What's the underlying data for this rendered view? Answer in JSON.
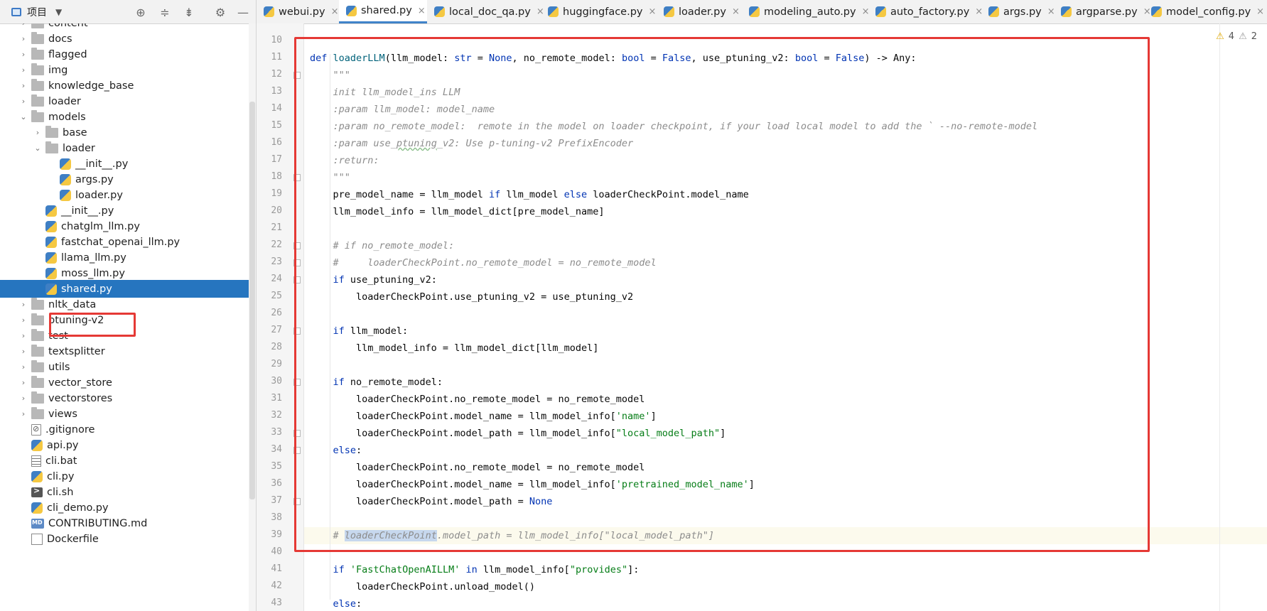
{
  "sidebar": {
    "title": "项目",
    "caret": "▼",
    "icons": {
      "locate": "⊕",
      "expand": "≑",
      "collapse": "⇟",
      "settings": "⚙",
      "hide": "—"
    },
    "tree": [
      {
        "label": "content",
        "arrow": "›",
        "icon": "folder",
        "depth": 1,
        "partial": true
      },
      {
        "label": "docs",
        "arrow": "›",
        "icon": "folder",
        "depth": 1
      },
      {
        "label": "flagged",
        "arrow": "›",
        "icon": "folder",
        "depth": 1
      },
      {
        "label": "img",
        "arrow": "›",
        "icon": "folder",
        "depth": 1
      },
      {
        "label": "knowledge_base",
        "arrow": "›",
        "icon": "folder",
        "depth": 1
      },
      {
        "label": "loader",
        "arrow": "›",
        "icon": "folder",
        "depth": 1
      },
      {
        "label": "models",
        "arrow": "⌄",
        "icon": "folder",
        "depth": 1
      },
      {
        "label": "base",
        "arrow": "›",
        "icon": "folder",
        "depth": 2
      },
      {
        "label": "loader",
        "arrow": "⌄",
        "icon": "folder",
        "depth": 2
      },
      {
        "label": "__init__.py",
        "arrow": "",
        "icon": "py",
        "depth": 3
      },
      {
        "label": "args.py",
        "arrow": "",
        "icon": "py",
        "depth": 3
      },
      {
        "label": "loader.py",
        "arrow": "",
        "icon": "py",
        "depth": 3
      },
      {
        "label": "__init__.py",
        "arrow": "",
        "icon": "py",
        "depth": 2
      },
      {
        "label": "chatglm_llm.py",
        "arrow": "",
        "icon": "py",
        "depth": 2
      },
      {
        "label": "fastchat_openai_llm.py",
        "arrow": "",
        "icon": "py",
        "depth": 2
      },
      {
        "label": "llama_llm.py",
        "arrow": "",
        "icon": "py",
        "depth": 2
      },
      {
        "label": "moss_llm.py",
        "arrow": "",
        "icon": "py",
        "depth": 2
      },
      {
        "label": "shared.py",
        "arrow": "",
        "icon": "py",
        "depth": 2,
        "selected": true
      },
      {
        "label": "nltk_data",
        "arrow": "›",
        "icon": "folder",
        "depth": 1
      },
      {
        "label": "ptuning-v2",
        "arrow": "›",
        "icon": "folder",
        "depth": 1
      },
      {
        "label": "test",
        "arrow": "›",
        "icon": "folder",
        "depth": 1
      },
      {
        "label": "textsplitter",
        "arrow": "›",
        "icon": "folder",
        "depth": 1
      },
      {
        "label": "utils",
        "arrow": "›",
        "icon": "folder",
        "depth": 1
      },
      {
        "label": "vector_store",
        "arrow": "›",
        "icon": "folder",
        "depth": 1
      },
      {
        "label": "vectorstores",
        "arrow": "›",
        "icon": "folder",
        "depth": 1
      },
      {
        "label": "views",
        "arrow": "›",
        "icon": "folder",
        "depth": 1
      },
      {
        "label": ".gitignore",
        "arrow": "",
        "icon": "git",
        "depth": 1
      },
      {
        "label": "api.py",
        "arrow": "",
        "icon": "py",
        "depth": 1
      },
      {
        "label": "cli.bat",
        "arrow": "",
        "icon": "bat",
        "depth": 1
      },
      {
        "label": "cli.py",
        "arrow": "",
        "icon": "py",
        "depth": 1
      },
      {
        "label": "cli.sh",
        "arrow": "",
        "icon": "sh",
        "depth": 1
      },
      {
        "label": "cli_demo.py",
        "arrow": "",
        "icon": "py",
        "depth": 1
      },
      {
        "label": "CONTRIBUTING.md",
        "arrow": "",
        "icon": "md",
        "depth": 1
      },
      {
        "label": "Dockerfile",
        "arrow": "",
        "icon": "docker",
        "depth": 1
      }
    ]
  },
  "tabs": [
    {
      "label": "webui.py",
      "active": false
    },
    {
      "label": "shared.py",
      "active": true
    },
    {
      "label": "local_doc_qa.py",
      "active": false
    },
    {
      "label": "huggingface.py",
      "active": false
    },
    {
      "label": "loader.py",
      "active": false
    },
    {
      "label": "modeling_auto.py",
      "active": false
    },
    {
      "label": "auto_factory.py",
      "active": false
    },
    {
      "label": "args.py",
      "active": false
    },
    {
      "label": "argparse.py",
      "active": false
    },
    {
      "label": "model_config.py",
      "active": false
    }
  ],
  "tab_close": "×",
  "warnings": {
    "warn_count": "4",
    "weak_count": "2",
    "warn_icon": "⚠",
    "weak_icon": "⚠"
  },
  "editor": {
    "current_line": 39,
    "lines": [
      {
        "n": 10,
        "code": ""
      },
      {
        "n": 11,
        "code": "def loaderLLM(llm_model: str = None, no_remote_model: bool = False, use_ptuning_v2: bool = False) -> Any:"
      },
      {
        "n": 12,
        "code": "    \"\"\""
      },
      {
        "n": 13,
        "code": "    init llm_model_ins LLM"
      },
      {
        "n": 14,
        "code": "    :param llm_model: model_name"
      },
      {
        "n": 15,
        "code": "    :param no_remote_model:  remote in the model on loader checkpoint, if your load local model to add the ` --no-remote-model"
      },
      {
        "n": 16,
        "code": "    :param use_ptuning_v2: Use p-tuning-v2 PrefixEncoder"
      },
      {
        "n": 17,
        "code": "    :return:"
      },
      {
        "n": 18,
        "code": "    \"\"\""
      },
      {
        "n": 19,
        "code": "    pre_model_name = llm_model if llm_model else loaderCheckPoint.model_name"
      },
      {
        "n": 20,
        "code": "    llm_model_info = llm_model_dict[pre_model_name]"
      },
      {
        "n": 21,
        "code": ""
      },
      {
        "n": 22,
        "code": "    # if no_remote_model:"
      },
      {
        "n": 23,
        "code": "    #     loaderCheckPoint.no_remote_model = no_remote_model"
      },
      {
        "n": 24,
        "code": "    if use_ptuning_v2:"
      },
      {
        "n": 25,
        "code": "        loaderCheckPoint.use_ptuning_v2 = use_ptuning_v2"
      },
      {
        "n": 26,
        "code": ""
      },
      {
        "n": 27,
        "code": "    if llm_model:"
      },
      {
        "n": 28,
        "code": "        llm_model_info = llm_model_dict[llm_model]"
      },
      {
        "n": 29,
        "code": ""
      },
      {
        "n": 30,
        "code": "    if no_remote_model:"
      },
      {
        "n": 31,
        "code": "        loaderCheckPoint.no_remote_model = no_remote_model"
      },
      {
        "n": 32,
        "code": "        loaderCheckPoint.model_name = llm_model_info['name']"
      },
      {
        "n": 33,
        "code": "        loaderCheckPoint.model_path = llm_model_info[\"local_model_path\"]"
      },
      {
        "n": 34,
        "code": "    else:"
      },
      {
        "n": 35,
        "code": "        loaderCheckPoint.no_remote_model = no_remote_model"
      },
      {
        "n": 36,
        "code": "        loaderCheckPoint.model_name = llm_model_info['pretrained_model_name']"
      },
      {
        "n": 37,
        "code": "        loaderCheckPoint.model_path = None"
      },
      {
        "n": 38,
        "code": ""
      },
      {
        "n": 39,
        "code": "    # loaderCheckPoint.model_path = llm_model_info[\"local_model_path\"]"
      },
      {
        "n": 40,
        "code": ""
      },
      {
        "n": 41,
        "code": "    if 'FastChatOpenAILLM' in llm_model_info[\"provides\"]:"
      },
      {
        "n": 42,
        "code": "        loaderCheckPoint.unload_model()"
      },
      {
        "n": 43,
        "code": "    else:"
      }
    ]
  },
  "colors": {
    "accent": "#2675bf",
    "highlight_box": "#e53935"
  }
}
